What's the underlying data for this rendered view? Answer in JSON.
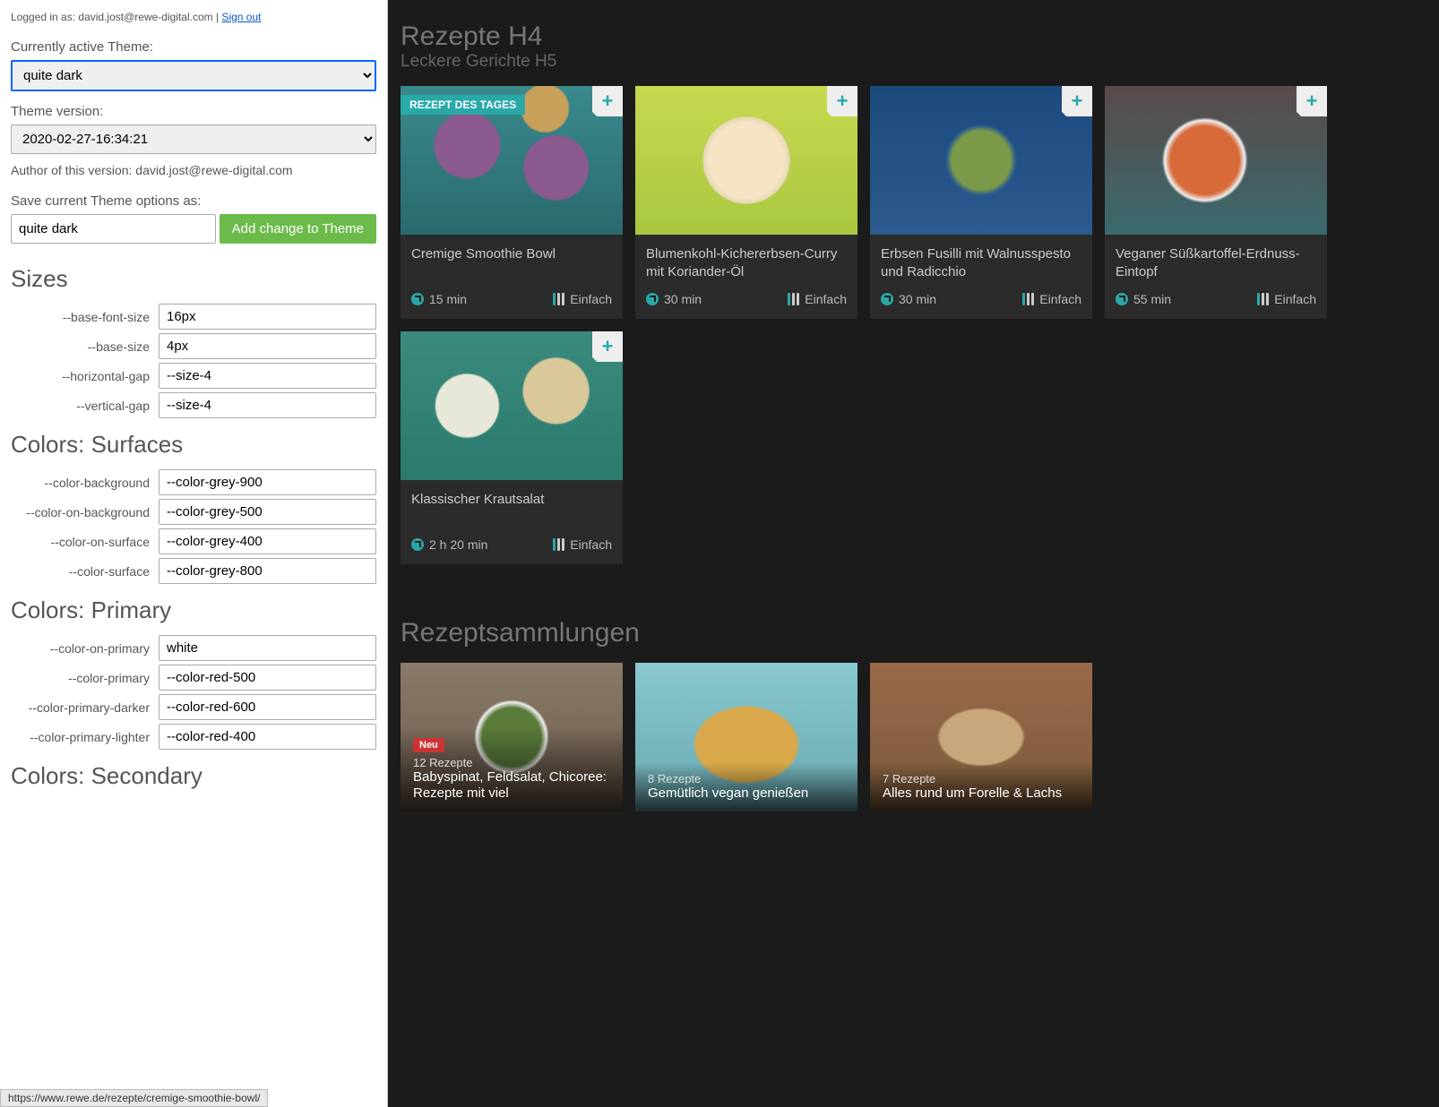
{
  "login": {
    "prefix": "Logged in as: ",
    "email": "david.jost@rewe-digital.com",
    "sep": " | ",
    "signout": "Sign out"
  },
  "theme": {
    "active_label": "Currently active Theme:",
    "active_value": "quite dark",
    "version_label": "Theme version:",
    "version_value": "2020-02-27-16:34:21",
    "author_label": "Author of this version: ",
    "author_value": "david.jost@rewe-digital.com",
    "save_label": "Save current Theme options as:",
    "save_value": "quite dark",
    "save_button": "Add change to Theme"
  },
  "sections": [
    {
      "title": "Sizes",
      "props": [
        {
          "key": "--base-font-size",
          "value": "16px"
        },
        {
          "key": "--base-size",
          "value": "4px"
        },
        {
          "key": "--horizontal-gap",
          "value": "--size-4"
        },
        {
          "key": "--vertical-gap",
          "value": "--size-4"
        }
      ]
    },
    {
      "title": "Colors: Surfaces",
      "props": [
        {
          "key": "--color-background",
          "value": "--color-grey-900"
        },
        {
          "key": "--color-on-background",
          "value": "--color-grey-500"
        },
        {
          "key": "--color-on-surface",
          "value": "--color-grey-400"
        },
        {
          "key": "--color-surface",
          "value": "--color-grey-800"
        }
      ]
    },
    {
      "title": "Colors: Primary",
      "props": [
        {
          "key": "--color-on-primary",
          "value": "white"
        },
        {
          "key": "--color-primary",
          "value": "--color-red-500"
        },
        {
          "key": "--color-primary-darker",
          "value": "--color-red-600"
        },
        {
          "key": "--color-primary-lighter",
          "value": "--color-red-400"
        }
      ]
    },
    {
      "title": "Colors: Secondary",
      "props": []
    }
  ],
  "preview": {
    "h4": "Rezepte H4",
    "h5": "Leckere Gerichte H5",
    "recipes": [
      {
        "title": "Cremige Smoothie Bowl",
        "time": "15 min",
        "difficulty": "Einfach",
        "badge": "REZEPT DES TAGES",
        "img": "food1"
      },
      {
        "title": "Blumenkohl-Kichererbsen-Curry mit Koriander-Öl",
        "time": "30 min",
        "difficulty": "Einfach",
        "img": "food2"
      },
      {
        "title": "Erbsen Fusilli mit Walnusspesto und Radicchio",
        "time": "30 min",
        "difficulty": "Einfach",
        "img": "food3"
      },
      {
        "title": "Veganer Süßkartoffel-Erdnuss-Eintopf",
        "time": "55 min",
        "difficulty": "Einfach",
        "img": "food4"
      },
      {
        "title": "Klassischer Krautsalat",
        "time": "2 h 20 min",
        "difficulty": "Einfach",
        "img": "food5"
      }
    ],
    "collections_head": "Rezeptsammlungen",
    "collections": [
      {
        "neu": "Neu",
        "count": "12 Rezepte",
        "title": "Babyspinat, Feldsalat, Chicoree: Rezepte mit viel",
        "img": "coll-a"
      },
      {
        "count": "8 Rezepte",
        "title": "Gemütlich vegan genießen",
        "img": "coll-b"
      },
      {
        "count": "7 Rezepte",
        "title": "Alles rund um Forelle & Lachs",
        "img": "coll-c"
      }
    ]
  },
  "status_url": "https://www.rewe.de/rezepte/cremige-smoothie-bowl/"
}
